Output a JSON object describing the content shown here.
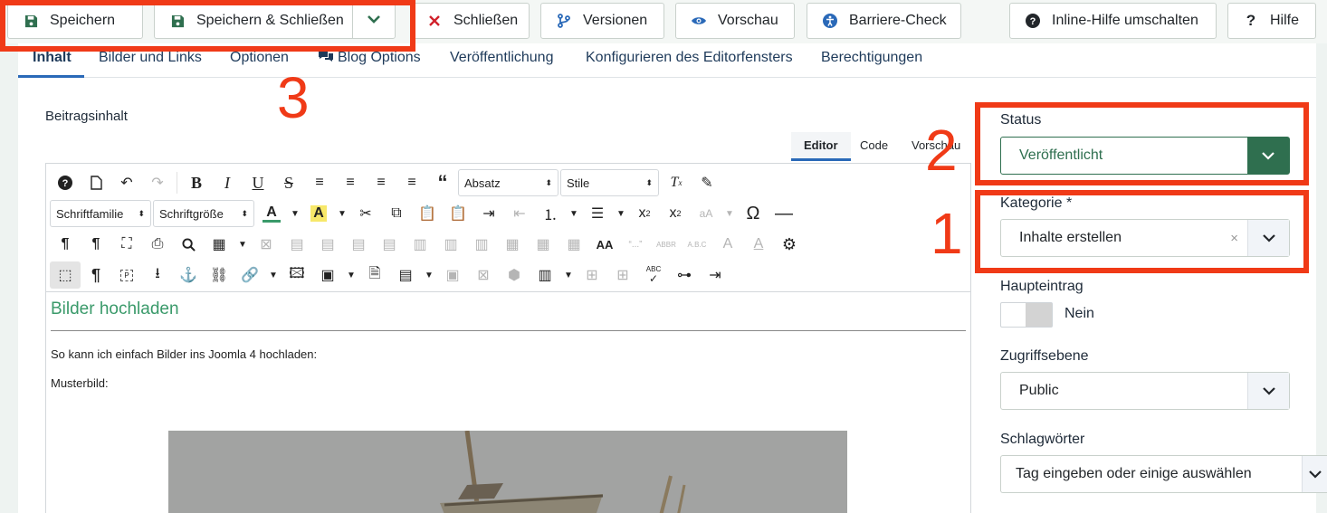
{
  "toolbar": {
    "save": "Speichern",
    "save_close": "Speichern & Schließen",
    "close": "Schließen",
    "versions": "Versionen",
    "preview": "Vorschau",
    "a11y_check": "Barriere-Check",
    "inline_help": "Inline-Hilfe umschalten",
    "help": "Hilfe"
  },
  "tabs": [
    "Inhalt",
    "Bilder und Links",
    "Optionen",
    "Blog Options",
    "Veröffentlichung",
    "Konfigurieren des Editorfensters",
    "Berechtigungen"
  ],
  "content": {
    "label": "Beitragsinhalt",
    "editor_tabs": [
      "Editor",
      "Code",
      "Vorschau"
    ],
    "selects": {
      "paragraph": "Absatz",
      "styles": "Stile",
      "font_family": "Schriftfamilie",
      "font_size": "Schriftgröße"
    },
    "body": {
      "heading": "Bilder hochladen",
      "paragraph1": "So kann ich einfach Bilder ins Joomla 4 hochladen:",
      "paragraph2": "Musterbild:"
    }
  },
  "sidebar": {
    "status_label": "Status",
    "status_value": "Veröffentlicht",
    "category_label": "Kategorie *",
    "category_value": "Inhalte erstellen",
    "category_clear": "×",
    "featured_label": "Haupteintrag",
    "featured_value": "Nein",
    "access_label": "Zugriffsebene",
    "access_value": "Public",
    "tags_label": "Schlagwörter",
    "tags_placeholder": "Tag eingeben oder einige auswählen"
  },
  "annotations": [
    "1",
    "2",
    "3"
  ],
  "colors": {
    "accent_red": "#f03a17",
    "status_green": "#2f6f4f",
    "link_blue": "#1e3a5a",
    "heading_green": "#3a9a6a"
  }
}
